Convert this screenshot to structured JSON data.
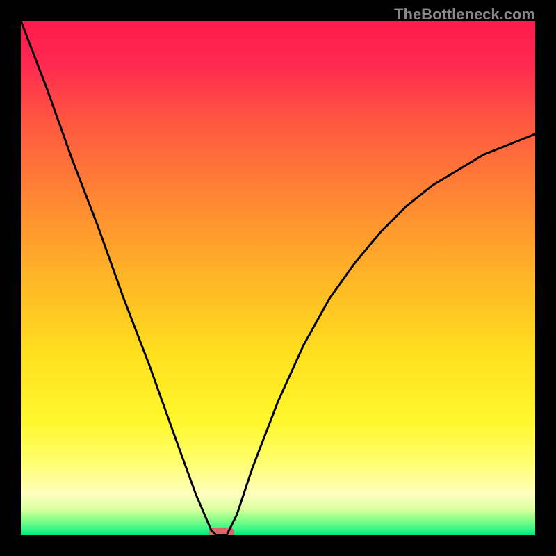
{
  "watermark": "TheBottleneck.com",
  "chart_data": {
    "type": "line",
    "title": "",
    "xlabel": "",
    "ylabel": "",
    "xlim": [
      0,
      100
    ],
    "ylim": [
      0,
      100
    ],
    "series": [
      {
        "name": "bottleneck-curve",
        "description": "V-shaped bottleneck curve with minimum around x=38-40",
        "x": [
          0,
          5,
          10,
          15,
          20,
          25,
          30,
          34,
          37,
          38,
          40,
          42,
          45,
          50,
          55,
          60,
          65,
          70,
          75,
          80,
          85,
          90,
          95,
          100
        ],
        "y": [
          100,
          87,
          73,
          60,
          46,
          33,
          19,
          8,
          1,
          0,
          0,
          4,
          13,
          26,
          37,
          46,
          53,
          59,
          64,
          68,
          71,
          74,
          76,
          78
        ]
      }
    ],
    "gradient_background": {
      "type": "vertical",
      "stops": [
        {
          "pos": 0,
          "color": "#ff1a4d"
        },
        {
          "pos": 8,
          "color": "#ff2850"
        },
        {
          "pos": 20,
          "color": "#ff5840"
        },
        {
          "pos": 35,
          "color": "#ff8833"
        },
        {
          "pos": 50,
          "color": "#ffb526"
        },
        {
          "pos": 65,
          "color": "#ffe01e"
        },
        {
          "pos": 78,
          "color": "#fff82c"
        },
        {
          "pos": 86,
          "color": "#fffe70"
        },
        {
          "pos": 92,
          "color": "#ffffc0"
        },
        {
          "pos": 95,
          "color": "#d8ff9e"
        },
        {
          "pos": 97,
          "color": "#88ff8a"
        },
        {
          "pos": 99,
          "color": "#30f585"
        },
        {
          "pos": 100,
          "color": "#00e878"
        }
      ]
    },
    "marker": {
      "x": 39,
      "y": 0.5,
      "width": 5,
      "height": 2,
      "color": "#d86868"
    }
  }
}
